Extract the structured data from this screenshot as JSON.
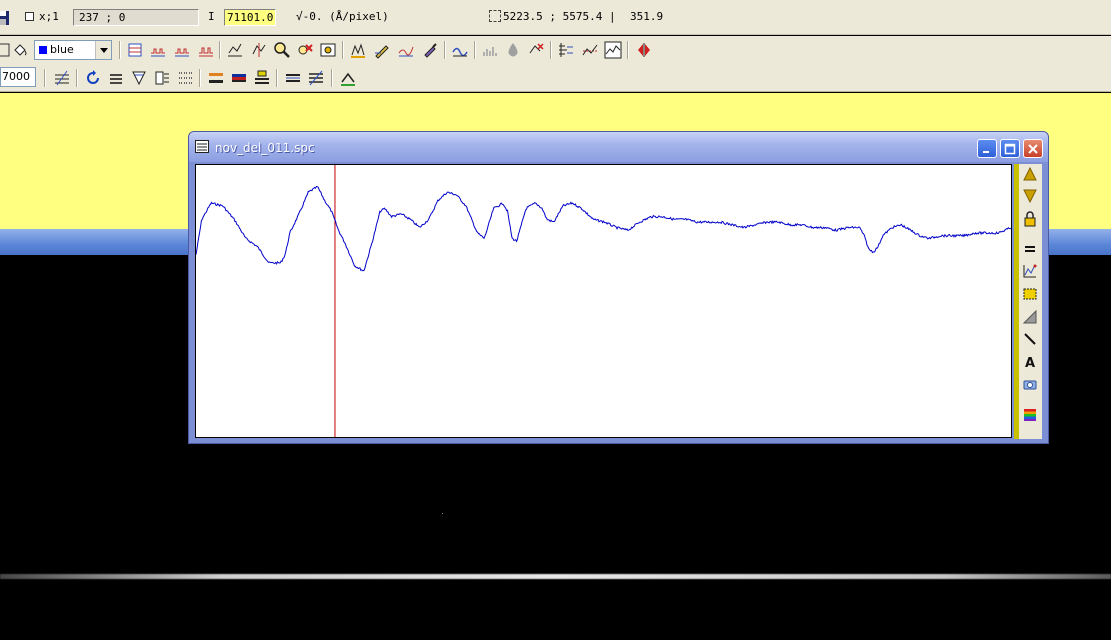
{
  "status": {
    "mode_label": "x;1",
    "position": "237 ; 0",
    "intensity_label": "I",
    "intensity_value": "71101.0",
    "dispersion": "-0. (Å/pixel)",
    "range": "5223.5 ; 5575.4 |",
    "range_value": "351.9"
  },
  "toolbar": {
    "color_select": {
      "value": "blue",
      "swatch": "#0000ff"
    },
    "number_field": "7000"
  },
  "window": {
    "title": "nov_del_011.spc"
  },
  "colors": {
    "workspace": "#FFFF80",
    "spectrum": "#0000C8",
    "cursor": "#C00000",
    "ribbon": "#C8C000"
  },
  "chart_data": {
    "type": "line",
    "title": "",
    "xlabel": "",
    "ylabel": "",
    "xlim": [
      5223.5,
      5575.4
    ],
    "ylim": [
      0,
      1
    ],
    "cursor_x": 5283.5,
    "grid": false,
    "series": [
      {
        "color": "#0000C8",
        "x": [
          5223.5,
          5226,
          5230,
          5235,
          5240,
          5245,
          5250,
          5255,
          5260,
          5262,
          5264,
          5268,
          5272,
          5276,
          5279,
          5282,
          5285,
          5288,
          5292,
          5296,
          5300,
          5303,
          5305,
          5308,
          5312,
          5316,
          5320,
          5324,
          5328,
          5332,
          5336,
          5340,
          5343,
          5345,
          5348,
          5352,
          5356,
          5358,
          5360,
          5362,
          5366,
          5370,
          5373,
          5375,
          5378,
          5382,
          5386,
          5390,
          5395,
          5400,
          5405,
          5410,
          5415,
          5420,
          5425,
          5430,
          5435,
          5440,
          5445,
          5450,
          5455,
          5460,
          5465,
          5470,
          5475,
          5480,
          5485,
          5490,
          5495,
          5500,
          5505,
          5510,
          5512,
          5514,
          5516,
          5518,
          5520,
          5524,
          5528,
          5532,
          5536,
          5540,
          5545,
          5550,
          5555,
          5560,
          5565,
          5570,
          5575.4
        ],
        "y": [
          0.67,
          0.8,
          0.86,
          0.85,
          0.8,
          0.73,
          0.7,
          0.64,
          0.64,
          0.67,
          0.75,
          0.82,
          0.9,
          0.92,
          0.87,
          0.83,
          0.76,
          0.71,
          0.63,
          0.61,
          0.73,
          0.83,
          0.84,
          0.81,
          0.82,
          0.8,
          0.77,
          0.8,
          0.87,
          0.9,
          0.89,
          0.85,
          0.79,
          0.75,
          0.73,
          0.84,
          0.86,
          0.83,
          0.73,
          0.72,
          0.84,
          0.86,
          0.84,
          0.8,
          0.79,
          0.85,
          0.86,
          0.84,
          0.8,
          0.79,
          0.77,
          0.76,
          0.79,
          0.81,
          0.81,
          0.8,
          0.8,
          0.79,
          0.79,
          0.79,
          0.78,
          0.77,
          0.78,
          0.79,
          0.79,
          0.78,
          0.78,
          0.77,
          0.77,
          0.76,
          0.77,
          0.77,
          0.74,
          0.69,
          0.68,
          0.7,
          0.74,
          0.77,
          0.78,
          0.76,
          0.74,
          0.73,
          0.74,
          0.74,
          0.74,
          0.75,
          0.75,
          0.75,
          0.77
        ]
      }
    ]
  }
}
